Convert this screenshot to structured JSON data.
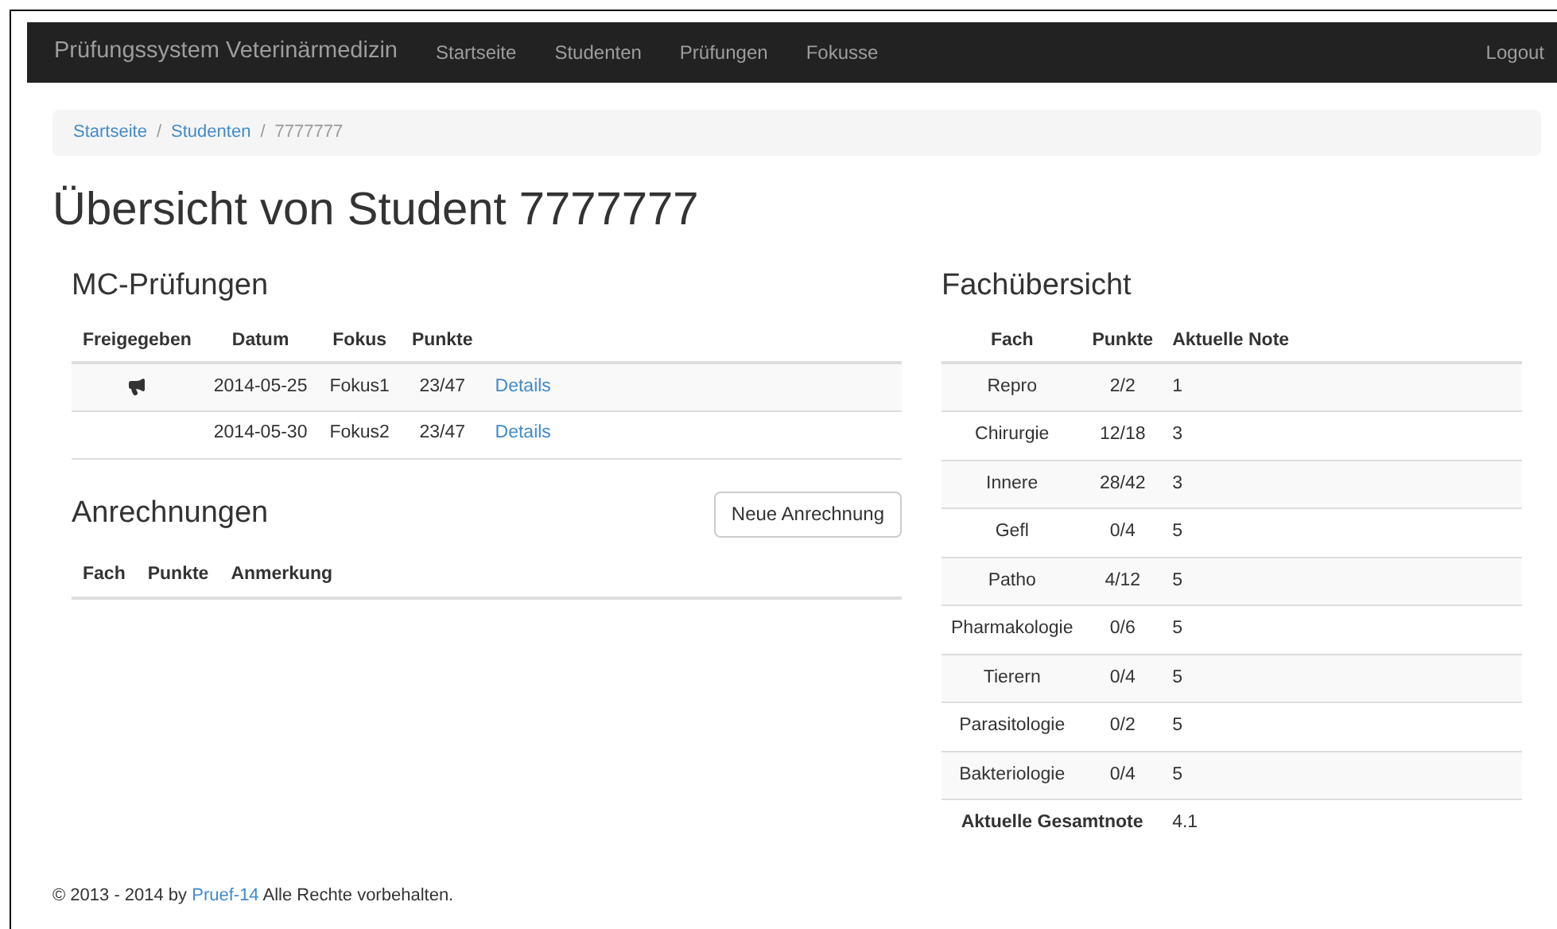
{
  "navbar": {
    "brand": "Prüfungssystem Veterinärmedizin",
    "items": [
      "Startseite",
      "Studenten",
      "Prüfungen",
      "Fokusse"
    ],
    "logout": "Logout"
  },
  "breadcrumb": {
    "links": [
      "Startseite",
      "Studenten"
    ],
    "separator": "/",
    "current": "7777777"
  },
  "title": "Übersicht von Student 7777777",
  "mc_exams": {
    "heading": "MC-Prüfungen",
    "columns": [
      "Freigegeben",
      "Datum",
      "Fokus",
      "Punkte"
    ],
    "rows": [
      {
        "released": true,
        "date": "2014-05-25",
        "focus": "Fokus1",
        "points": "23/47",
        "link": "Details"
      },
      {
        "released": false,
        "date": "2014-05-30",
        "focus": "Fokus2",
        "points": "23/47",
        "link": "Details"
      }
    ]
  },
  "credits": {
    "heading": "Anrechnungen",
    "button": "Neue Anrechnung",
    "columns": [
      "Fach",
      "Punkte",
      "Anmerkung"
    ]
  },
  "subjects": {
    "heading": "Fachübersicht",
    "columns": [
      "Fach",
      "Punkte",
      "Aktuelle Note"
    ],
    "rows": [
      {
        "subject": "Repro",
        "points": "2/2",
        "grade": "1"
      },
      {
        "subject": "Chirurgie",
        "points": "12/18",
        "grade": "3"
      },
      {
        "subject": "Innere",
        "points": "28/42",
        "grade": "3"
      },
      {
        "subject": "Gefl",
        "points": "0/4",
        "grade": "5"
      },
      {
        "subject": "Patho",
        "points": "4/12",
        "grade": "5"
      },
      {
        "subject": "Pharmakologie",
        "points": "0/6",
        "grade": "5"
      },
      {
        "subject": "Tierern",
        "points": "0/4",
        "grade": "5"
      },
      {
        "subject": "Parasitologie",
        "points": "0/2",
        "grade": "5"
      },
      {
        "subject": "Bakteriologie",
        "points": "0/4",
        "grade": "5"
      }
    ],
    "total_label": "Aktuelle Gesamtnote",
    "total": "4.1"
  },
  "footer": {
    "before": "© 2013 - 2014 by ",
    "link": "Pruef-14",
    "after": " Alle Rechte vorbehalten."
  }
}
